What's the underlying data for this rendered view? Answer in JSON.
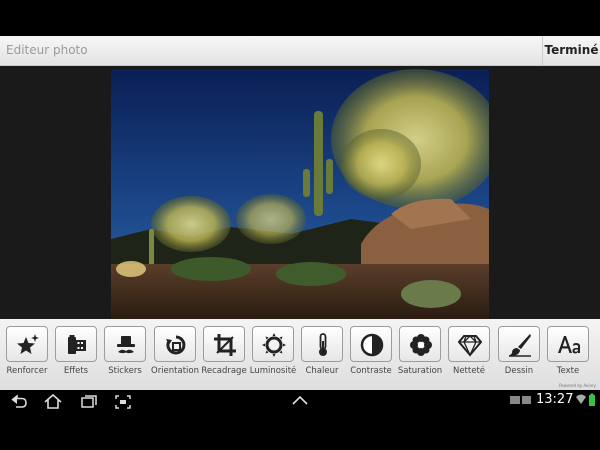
{
  "header": {
    "title": "Editeur photo",
    "done_label": "Terminé"
  },
  "photo": {
    "icon": "desert-cactus-photo"
  },
  "tools": [
    {
      "label": "Renforcer",
      "icon": "star-sparkle-icon"
    },
    {
      "label": "Effets",
      "icon": "film-roll-icon"
    },
    {
      "label": "Stickers",
      "icon": "hat-mustache-icon"
    },
    {
      "label": "Orientation",
      "icon": "rotate-icon"
    },
    {
      "label": "Recadrage",
      "icon": "crop-icon"
    },
    {
      "label": "Luminosité",
      "icon": "sun-icon"
    },
    {
      "label": "Chaleur",
      "icon": "thermometer-icon"
    },
    {
      "label": "Contraste",
      "icon": "contrast-icon"
    },
    {
      "label": "Saturation",
      "icon": "flower-icon"
    },
    {
      "label": "Netteté",
      "icon": "diamond-icon"
    },
    {
      "label": "Dessin",
      "icon": "brush-icon"
    },
    {
      "label": "Texte",
      "icon": "text-icon"
    }
  ],
  "pager": {
    "pages": 3,
    "active": 0
  },
  "powered_by": "Powered by Aviary",
  "status": {
    "time": "13:27"
  },
  "colors": {
    "accent": "#3a9ad9",
    "toolbar_bg": "#e8e8e8",
    "sky": "#0f2a66"
  }
}
